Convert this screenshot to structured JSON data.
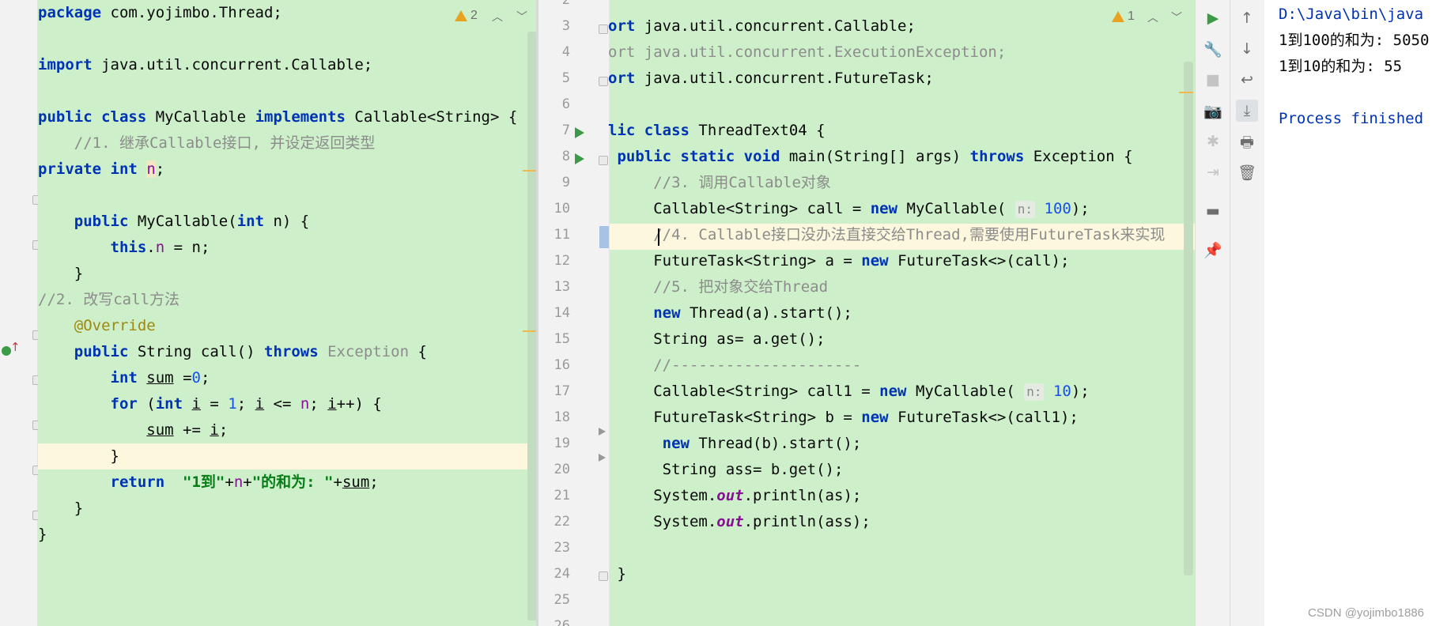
{
  "left_editor": {
    "warning_count": "2",
    "lines": [
      {
        "segs": [
          {
            "t": "package",
            "c": "kw"
          },
          {
            "t": " com.yojimbo.Thread;"
          }
        ]
      },
      {
        "segs": []
      },
      {
        "segs": [
          {
            "t": "import",
            "c": "kw"
          },
          {
            "t": " java.util.concurrent.Callable;"
          }
        ]
      },
      {
        "segs": []
      },
      {
        "segs": [
          {
            "t": "public",
            "c": "kw"
          },
          {
            "t": " "
          },
          {
            "t": "class",
            "c": "kw"
          },
          {
            "t": " MyCallable "
          },
          {
            "t": "implements",
            "c": "kw"
          },
          {
            "t": " Callable<String> {"
          }
        ]
      },
      {
        "segs": [
          {
            "t": "    //1. 继承Callable接口, 并设定返回类型",
            "c": "cmt"
          }
        ]
      },
      {
        "segs": [
          {
            "t": "private",
            "c": "kw"
          },
          {
            "t": " "
          },
          {
            "t": "int",
            "c": "kw"
          },
          {
            "t": " "
          },
          {
            "t": "n",
            "c": "fld ident-hl"
          },
          {
            "t": ";"
          }
        ]
      },
      {
        "segs": []
      },
      {
        "segs": [
          {
            "t": "    "
          },
          {
            "t": "public",
            "c": "kw"
          },
          {
            "t": " MyCallable("
          },
          {
            "t": "int",
            "c": "kw"
          },
          {
            "t": " n) {"
          }
        ]
      },
      {
        "segs": [
          {
            "t": "        "
          },
          {
            "t": "this",
            "c": "kw"
          },
          {
            "t": "."
          },
          {
            "t": "n",
            "c": "fld"
          },
          {
            "t": " = n;"
          }
        ]
      },
      {
        "segs": [
          {
            "t": "    }"
          }
        ]
      },
      {
        "segs": [
          {
            "t": "//2. 改写call方法",
            "c": "cmt"
          }
        ]
      },
      {
        "segs": [
          {
            "t": "    "
          },
          {
            "t": "@Override",
            "c": "ann"
          }
        ]
      },
      {
        "segs": [
          {
            "t": "    "
          },
          {
            "t": "public",
            "c": "kw"
          },
          {
            "t": " String call() "
          },
          {
            "t": "throws",
            "c": "kw"
          },
          {
            "t": " "
          },
          {
            "t": "Exception",
            "c": "dim"
          },
          {
            "t": " {"
          }
        ]
      },
      {
        "segs": [
          {
            "t": "        "
          },
          {
            "t": "int",
            "c": "kw"
          },
          {
            "t": " "
          },
          {
            "t": "sum",
            "c": "ul"
          },
          {
            "t": " ="
          },
          {
            "t": "0",
            "c": "num"
          },
          {
            "t": ";"
          }
        ]
      },
      {
        "segs": [
          {
            "t": "        "
          },
          {
            "t": "for",
            "c": "kw"
          },
          {
            "t": " ("
          },
          {
            "t": "int",
            "c": "kw"
          },
          {
            "t": " "
          },
          {
            "t": "i",
            "c": "ul"
          },
          {
            "t": " = "
          },
          {
            "t": "1",
            "c": "num"
          },
          {
            "t": "; "
          },
          {
            "t": "i",
            "c": "ul"
          },
          {
            "t": " <= "
          },
          {
            "t": "n",
            "c": "fld"
          },
          {
            "t": "; "
          },
          {
            "t": "i",
            "c": "ul"
          },
          {
            "t": "++) {"
          }
        ]
      },
      {
        "segs": [
          {
            "t": "            "
          },
          {
            "t": "sum",
            "c": "ul"
          },
          {
            "t": " += "
          },
          {
            "t": "i",
            "c": "ul"
          },
          {
            "t": ";"
          }
        ]
      },
      {
        "segs": [
          {
            "t": "        }"
          }
        ]
      },
      {
        "segs": [
          {
            "t": "        "
          },
          {
            "t": "return",
            "c": "kw"
          },
          {
            "t": "  "
          },
          {
            "t": "\"1到\"",
            "c": "str"
          },
          {
            "t": "+"
          },
          {
            "t": "n",
            "c": "fld"
          },
          {
            "t": "+"
          },
          {
            "t": "\"的和为: \"",
            "c": "str"
          },
          {
            "t": "+"
          },
          {
            "t": "sum",
            "c": "ul"
          },
          {
            "t": ";"
          }
        ]
      },
      {
        "segs": [
          {
            "t": "    }"
          }
        ]
      },
      {
        "segs": [
          {
            "t": "}"
          }
        ]
      }
    ]
  },
  "right_editor": {
    "warning_count": "1",
    "lines": [
      {
        "no": "2",
        "segs": []
      },
      {
        "no": "3",
        "segs": [
          {
            "t": "ort",
            "c": "kw"
          },
          {
            "t": " java.util.concurrent.Callable;"
          }
        ]
      },
      {
        "no": "4",
        "segs": [
          {
            "t": "ort java.util.concurrent.ExecutionException;",
            "c": "dim"
          }
        ]
      },
      {
        "no": "5",
        "segs": [
          {
            "t": "ort",
            "c": "kw"
          },
          {
            "t": " java.util.concurrent.FutureTask;"
          }
        ]
      },
      {
        "no": "6",
        "segs": []
      },
      {
        "no": "7",
        "segs": [
          {
            "t": "lic",
            "c": "kw"
          },
          {
            "t": " "
          },
          {
            "t": "class",
            "c": "kw"
          },
          {
            "t": " ThreadText04 {"
          }
        ]
      },
      {
        "no": "8",
        "segs": [
          {
            "t": " "
          },
          {
            "t": "public",
            "c": "kw"
          },
          {
            "t": " "
          },
          {
            "t": "static",
            "c": "kw"
          },
          {
            "t": " "
          },
          {
            "t": "void",
            "c": "kw"
          },
          {
            "t": " main(String[] args) "
          },
          {
            "t": "throws",
            "c": "kw"
          },
          {
            "t": " Exception {"
          }
        ]
      },
      {
        "no": "9",
        "segs": [
          {
            "t": "     //3. 调用Callable对象",
            "c": "cmt"
          }
        ]
      },
      {
        "no": "10",
        "segs": [
          {
            "t": "     Callable<String> call = "
          },
          {
            "t": "new",
            "c": "kw"
          },
          {
            "t": " MyCallable( "
          },
          {
            "t": "n:",
            "c": "hint"
          },
          {
            "t": " "
          },
          {
            "t": "100",
            "c": "num"
          },
          {
            "t": ");"
          }
        ]
      },
      {
        "no": "11",
        "segs": [
          {
            "t": "     //4. Callable接口没办法直接交给Thread,需要使用FutureTask来实现",
            "c": "cmt"
          }
        ]
      },
      {
        "no": "12",
        "segs": [
          {
            "t": "     FutureTask<String> a = "
          },
          {
            "t": "new",
            "c": "kw"
          },
          {
            "t": " FutureTask<>(call);"
          }
        ]
      },
      {
        "no": "13",
        "segs": [
          {
            "t": "     //5. 把对象交给Thread",
            "c": "cmt"
          }
        ]
      },
      {
        "no": "14",
        "segs": [
          {
            "t": "     "
          },
          {
            "t": "new",
            "c": "kw"
          },
          {
            "t": " Thread(a).start();"
          }
        ]
      },
      {
        "no": "15",
        "segs": [
          {
            "t": "     String as= a.get();"
          }
        ]
      },
      {
        "no": "16",
        "segs": [
          {
            "t": "     //---------------------",
            "c": "cmt"
          }
        ]
      },
      {
        "no": "17",
        "segs": [
          {
            "t": "     Callable<String> call1 = "
          },
          {
            "t": "new",
            "c": "kw"
          },
          {
            "t": " MyCallable( "
          },
          {
            "t": "n:",
            "c": "hint"
          },
          {
            "t": " "
          },
          {
            "t": "10",
            "c": "num"
          },
          {
            "t": ");"
          }
        ]
      },
      {
        "no": "18",
        "segs": [
          {
            "t": "     FutureTask<String> b = "
          },
          {
            "t": "new",
            "c": "kw"
          },
          {
            "t": " FutureTask<>(call1);"
          }
        ]
      },
      {
        "no": "19",
        "segs": [
          {
            "t": "      "
          },
          {
            "t": "new",
            "c": "kw"
          },
          {
            "t": " Thread(b).start();"
          }
        ]
      },
      {
        "no": "20",
        "segs": [
          {
            "t": "      String ass= b.get();"
          }
        ]
      },
      {
        "no": "21",
        "segs": [
          {
            "t": "     System."
          },
          {
            "t": "out",
            "c": "fld-static"
          },
          {
            "t": ".println(as);"
          }
        ]
      },
      {
        "no": "22",
        "segs": [
          {
            "t": "     System."
          },
          {
            "t": "out",
            "c": "fld-static"
          },
          {
            "t": ".println(ass);"
          }
        ]
      },
      {
        "no": "23",
        "segs": []
      },
      {
        "no": "24",
        "segs": [
          {
            "t": " }"
          }
        ]
      },
      {
        "no": "25",
        "segs": []
      },
      {
        "no": "26",
        "segs": []
      }
    ]
  },
  "run_toolbar": {
    "col1": [
      {
        "name": "rerun-icon",
        "glyph": "▶",
        "state": "green"
      },
      {
        "name": "wrench-icon",
        "glyph": "🔧",
        "state": ""
      },
      {
        "name": "stop-icon",
        "glyph": "■",
        "state": "disabled"
      },
      {
        "name": "camera-icon",
        "glyph": "📷",
        "state": "disabled"
      },
      {
        "name": "debug-bug-icon",
        "glyph": "✱",
        "state": "disabled"
      },
      {
        "name": "exit-icon",
        "glyph": "⇥",
        "state": "disabled"
      },
      {
        "name": "layout-icon",
        "glyph": "▬",
        "state": ""
      },
      {
        "name": "pin-icon",
        "glyph": "📌",
        "state": ""
      }
    ],
    "col2": [
      {
        "name": "arrow-up-icon",
        "glyph": "↑",
        "state": ""
      },
      {
        "name": "arrow-down-icon",
        "glyph": "↓",
        "state": ""
      },
      {
        "name": "soft-wrap-icon",
        "glyph": "↩",
        "state": ""
      },
      {
        "name": "scroll-to-end-icon",
        "glyph": "⤓",
        "state": "active"
      },
      {
        "name": "print-icon",
        "glyph": "🖶",
        "state": ""
      },
      {
        "name": "trash-icon",
        "glyph": "🗑",
        "state": ""
      }
    ]
  },
  "console": {
    "command": "D:\\Java\\bin\\java",
    "output_1": "1到100的和为: 5050",
    "output_2": "1到10的和为: 55",
    "finished": "Process finished",
    "watermark": "CSDN @yojimbo1886"
  }
}
